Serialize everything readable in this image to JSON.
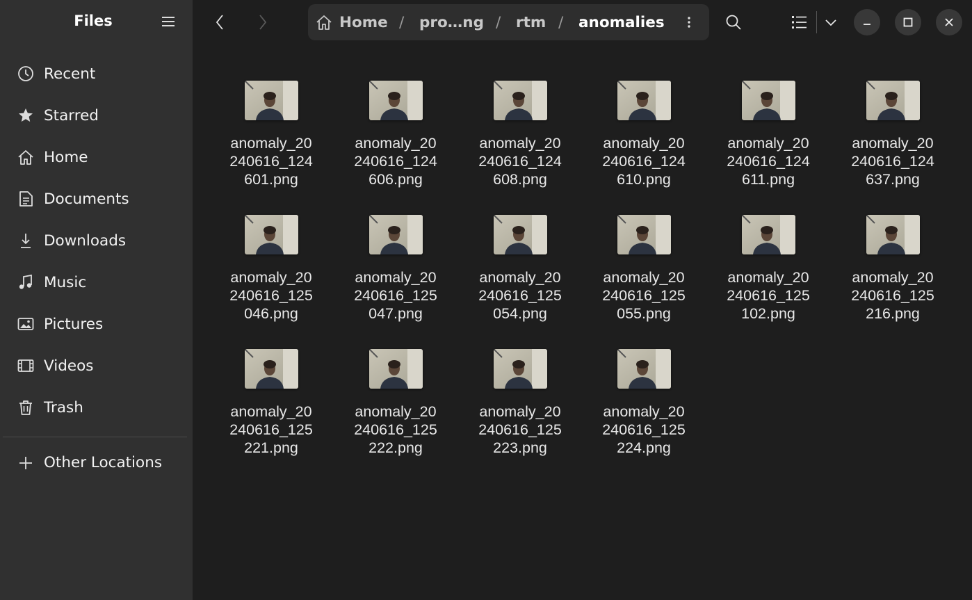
{
  "app": {
    "title": "Files"
  },
  "sidebar": {
    "items": [
      {
        "label": "Recent",
        "icon": "clock-icon"
      },
      {
        "label": "Starred",
        "icon": "star-icon"
      },
      {
        "label": "Home",
        "icon": "home-icon"
      },
      {
        "label": "Documents",
        "icon": "document-icon"
      },
      {
        "label": "Downloads",
        "icon": "download-icon"
      },
      {
        "label": "Music",
        "icon": "music-icon"
      },
      {
        "label": "Pictures",
        "icon": "picture-icon"
      },
      {
        "label": "Videos",
        "icon": "video-icon"
      },
      {
        "label": "Trash",
        "icon": "trash-icon"
      }
    ],
    "other_locations": "Other Locations"
  },
  "pathbar": {
    "crumbs": [
      "Home",
      "pro…ng",
      "rtm",
      "anomalies"
    ],
    "separator": "/"
  },
  "files": [
    {
      "l1": "anomaly_20",
      "l2": "240616_124",
      "l3": "601.png"
    },
    {
      "l1": "anomaly_20",
      "l2": "240616_124",
      "l3": "606.png"
    },
    {
      "l1": "anomaly_20",
      "l2": "240616_124",
      "l3": "608.png"
    },
    {
      "l1": "anomaly_20",
      "l2": "240616_124",
      "l3": "610.png"
    },
    {
      "l1": "anomaly_20",
      "l2": "240616_124",
      "l3": "611.png"
    },
    {
      "l1": "anomaly_20",
      "l2": "240616_124",
      "l3": "637.png"
    },
    {
      "l1": "anomaly_20",
      "l2": "240616_125",
      "l3": "046.png"
    },
    {
      "l1": "anomaly_20",
      "l2": "240616_125",
      "l3": "047.png"
    },
    {
      "l1": "anomaly_20",
      "l2": "240616_125",
      "l3": "054.png"
    },
    {
      "l1": "anomaly_20",
      "l2": "240616_125",
      "l3": "055.png"
    },
    {
      "l1": "anomaly_20",
      "l2": "240616_125",
      "l3": "102.png"
    },
    {
      "l1": "anomaly_20",
      "l2": "240616_125",
      "l3": "216.png"
    },
    {
      "l1": "anomaly_20",
      "l2": "240616_125",
      "l3": "221.png"
    },
    {
      "l1": "anomaly_20",
      "l2": "240616_125",
      "l3": "222.png"
    },
    {
      "l1": "anomaly_20",
      "l2": "240616_125",
      "l3": "223.png"
    },
    {
      "l1": "anomaly_20",
      "l2": "240616_125",
      "l3": "224.png"
    }
  ],
  "colors": {
    "sidebar_bg": "#303030",
    "content_bg": "#1e1e1e",
    "pathbar_bg": "#2e2e2e",
    "text": "#ffffff"
  }
}
